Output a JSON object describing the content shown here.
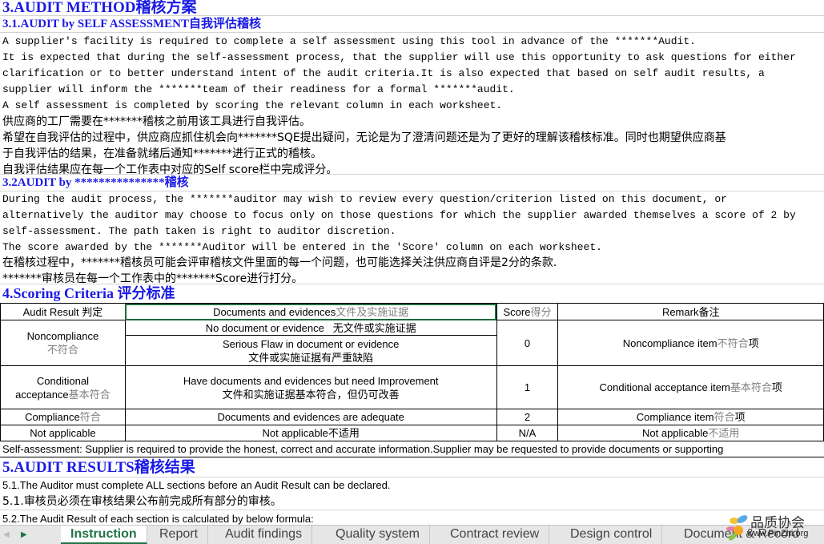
{
  "section3": {
    "title": "3.AUDIT METHOD稽核方案",
    "s31": {
      "title": "3.1.AUDIT by SELF ASSESSMENT自我评估稽核",
      "lines": [
        "A supplier's facility is required to complete a self assessment using this tool in advance of the *******Audit.",
        "It is expected that during the self-assessment process, that the supplier will use this opportunity to ask questions for either",
        "clarification or to better understand intent of the audit criteria.It is also expected that based on self audit results, a",
        "supplier will inform the *******team of their readiness for a formal *******audit.",
        "A self assessment is completed by scoring the relevant column in each worksheet."
      ],
      "cn_lines": [
        "供应商的工厂需要在*******稽核之前用该工具进行自我评估。",
        "希望在自我评估的过程中，供应商应抓住机会向*******SQE提出疑问，无论是为了澄清问题还是为了更好的理解该稽核标准。同时也期望供应商基",
        "于自我评估的结果，在准备就绪后通知*******进行正式的稽核。",
        "自我评估结果应在每一个工作表中对应的Self score栏中完成评分。"
      ]
    },
    "s32": {
      "title": "3.2AUDIT by ***************稽核",
      "lines": [
        "During the audit process, the *******auditor may wish to review every question/criterion listed on this document, or",
        "alternatively the auditor may choose to focus only on those questions for which the supplier awarded themselves a score of 2 by",
        "self-assessment. The path taken is right to auditor discretion.",
        "The score awarded by the *******Auditor will be entered in the 'Score' column on each worksheet."
      ],
      "cn_lines": [
        "在稽核过程中，*******稽核员可能会评审稽核文件里面的每一个问题，也可能选择关注供应商自评是2分的条款.",
        "*******审核员在每一个工作表中的*******Score进行打分。"
      ]
    }
  },
  "section4": {
    "title": "4.Scoring Criteria 评分标准",
    "headers": {
      "result_en": "Audit Result ",
      "result_cn": "判定",
      "docs_en": "Documents and evidences",
      "docs_cn": "文件及实施证据",
      "score_en": "Score",
      "score_cn": "得分",
      "remark_en": "Remark",
      "remark_cn": "备注"
    },
    "rows": {
      "noncompliance": {
        "result_en": "Noncompliance",
        "result_cn": "不符合",
        "doc1": "No document or evidence   无文件或实施证据",
        "doc2_en": "Serious Flaw in document or evidence",
        "doc2_cn": "文件或实施证据有严重缺陷",
        "score": "0",
        "remark_en": "Noncompliance item",
        "remark_cn": "不符合",
        "remark_suffix": "项"
      },
      "conditional": {
        "result_en1": "Conditional",
        "result_en2": "acceptance",
        "result_cn": "基本符合",
        "doc_en": "Have documents and evidences but need Improvement",
        "doc_cn": "文件和实施证据基本符合，但仍可改善",
        "score": "1",
        "remark_en": "Conditional acceptance item",
        "remark_cn": "基本符合",
        "remark_suffix": "项"
      },
      "compliance": {
        "result_en": "Compliance",
        "result_cn": "符合",
        "doc": "Documents and evidences are adequate",
        "score": "2",
        "remark_en": "Compliance item",
        "remark_cn": "符合",
        "remark_suffix": "项"
      },
      "na": {
        "result": "Not applicable",
        "doc": "Not applicable不适用",
        "score": "N/A",
        "remark_en": "Not applicable",
        "remark_cn": "不适用"
      }
    },
    "note": "Self-assessment: Supplier is required to provide the honest, correct and accurate information.Supplier may be requested to provide documents or supporting"
  },
  "section5": {
    "title": "5.AUDIT RESULTS稽核结果",
    "lines": [
      "5.1.The Auditor must complete ALL sections before an Audit Result can be declared.",
      "5.1.审核员必须在审核结果公布前完成所有部分的审核。",
      "5.2.The Audit Result of each section is calculated by below formula:"
    ]
  },
  "sheet_tabs": {
    "active": "Instruction",
    "tabs": [
      "Instruction",
      "Report",
      "Audit findings",
      "Quality system",
      "Contract review",
      "Design control",
      "Document & Record"
    ]
  },
  "watermark": {
    "text": "品质协会",
    "url": "www.PinZhi.org"
  },
  "colors": {
    "heading": "#1a1ae6",
    "active_tab": "#217346",
    "muted": "#808080"
  }
}
